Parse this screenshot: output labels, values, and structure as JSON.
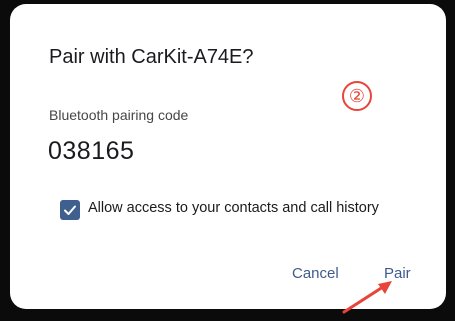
{
  "dialog": {
    "title": "Pair with CarKit-A74E?",
    "code_label": "Bluetooth pairing code",
    "code_value": "038165",
    "allow_access": {
      "label": "Allow access to your contacts and call history",
      "checked": true
    },
    "buttons": {
      "cancel": "Cancel",
      "pair": "Pair"
    }
  },
  "annotation": {
    "step": "②",
    "color": "#e8443a"
  },
  "colors": {
    "accent": "#3f5f8f",
    "background": "#0b0b0b",
    "dialog": "#ffffff"
  }
}
